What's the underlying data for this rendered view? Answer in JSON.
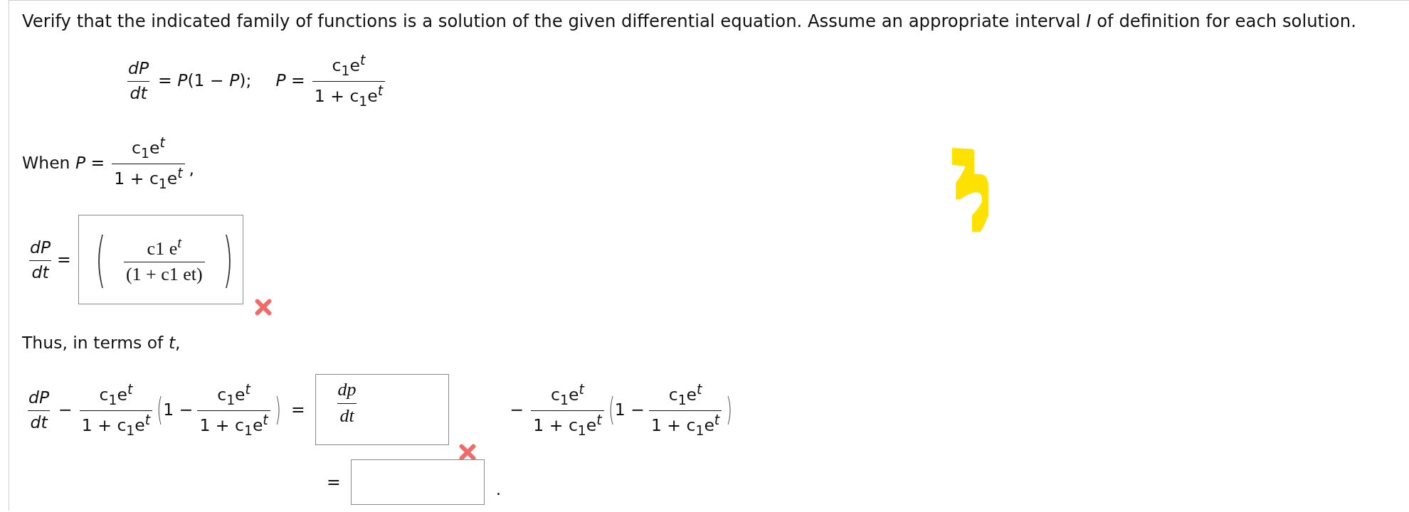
{
  "instructions": "Verify that the indicated family of functions is a solution of the given differential equation. Assume an appropriate interval *I* of definition for each solution.",
  "given": {
    "derivative": {
      "num": "dP",
      "den": "dt"
    },
    "equation_rhs": "= *P*(1 − *P*);",
    "solution_lhs": "*P* =",
    "solution": {
      "num": "c$_{1}$e$^{t}$",
      "den": "1 + c$_{1}$e$^{t}$"
    }
  },
  "when": {
    "text": "When *P* =",
    "fraction": {
      "num": "c$_{1}$e$^{t}$",
      "den": "1 + c$_{1}$e$^{t}$"
    },
    "punct": ","
  },
  "answer_1": {
    "lhs": {
      "num": "dP",
      "den": "dt"
    },
    "equals": "=",
    "open": "(",
    "close": ")",
    "value": {
      "num": "c1 e$^{t}$",
      "den": "(1 + c1 et)"
    },
    "correct": false
  },
  "thus": "Thus, in terms of *t*,",
  "check_row": {
    "lhs": {
      "num": "dP",
      "den": "dt"
    },
    "minus": "−",
    "frac1": {
      "num": "c$_{1}$e$^{t}$",
      "den": "1 + c$_{1}$e$^{t}$"
    },
    "open": "(",
    "one_minus": "1 −",
    "frac2": {
      "num": "c$_{1}$e$^{t}$",
      "den": "1 + c$_{1}$e$^{t}$"
    },
    "close": ")",
    "equals": "=",
    "answer": {
      "num": "dp",
      "den": "dt",
      "correct": false
    },
    "tail": {
      "minus": "−",
      "frac1": {
        "num": "c$_{1}$e$^{t}$",
        "den": "1 + c$_{1}$e$^{t}$"
      },
      "open": "(",
      "one_minus": "1 −",
      "frac2": {
        "num": "c$_{1}$e$^{t}$",
        "den": "1 + c$_{1}$e$^{t}$"
      },
      "close": ")"
    }
  },
  "final_row": {
    "equals": "=",
    "period": "."
  }
}
